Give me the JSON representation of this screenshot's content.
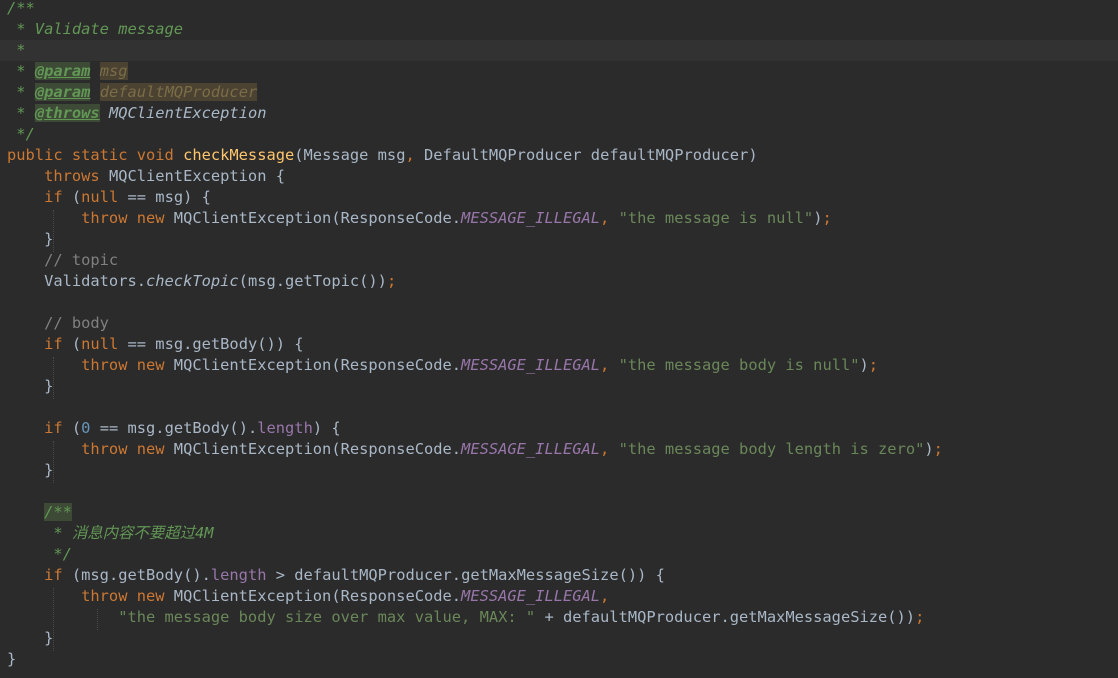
{
  "editor": {
    "theme": "darcula",
    "colors": {
      "background": "#2b2b2b",
      "current_line": "#323232",
      "default": "#a9b7c6",
      "keyword": "#cc7832",
      "string": "#6a8759",
      "doc_comment": "#629755",
      "line_comment": "#808080",
      "number": "#6897bb",
      "static_field": "#9876aa",
      "method_decl": "#ffc66d",
      "doc_tag": "#629755",
      "doc_tag_bg": "#3c4a36",
      "param_name_bg": "#4b4232"
    },
    "lines": [
      {
        "tokens": [
          {
            "t": "/**",
            "c": "doc_comment",
            "i": true
          }
        ]
      },
      {
        "tokens": [
          {
            "t": " * Validate message",
            "c": "doc_comment",
            "i": true
          }
        ]
      },
      {
        "current": true,
        "tokens": [
          {
            "t": " *",
            "c": "doc_comment",
            "i": true
          }
        ]
      },
      {
        "tokens": [
          {
            "t": " * ",
            "c": "doc_comment",
            "i": true
          },
          {
            "t": "@param",
            "c": "doc_tag",
            "i": true,
            "b": true,
            "u": true,
            "bg": "doc_tag_bg"
          },
          {
            "t": " ",
            "c": "doc_comment",
            "i": true
          },
          {
            "t": "msg",
            "c": "doc_comment",
            "i": true,
            "bg": "param_name_bg",
            "color": "#7a6d48"
          }
        ]
      },
      {
        "tokens": [
          {
            "t": " * ",
            "c": "doc_comment",
            "i": true
          },
          {
            "t": "@param",
            "c": "doc_tag",
            "i": true,
            "b": true,
            "u": true,
            "bg": "doc_tag_bg"
          },
          {
            "t": " ",
            "c": "doc_comment",
            "i": true
          },
          {
            "t": "defaultMQProducer",
            "c": "doc_comment",
            "i": true,
            "bg": "param_name_bg",
            "color": "#7a6d48"
          }
        ]
      },
      {
        "tokens": [
          {
            "t": " * ",
            "c": "doc_comment",
            "i": true
          },
          {
            "t": "@throws",
            "c": "doc_tag",
            "i": true,
            "b": true,
            "u": true,
            "bg": "doc_tag_bg"
          },
          {
            "t": " ",
            "c": "doc_comment",
            "i": true
          },
          {
            "t": "MQClientException",
            "c": "default",
            "i": true
          }
        ]
      },
      {
        "tokens": [
          {
            "t": " */",
            "c": "doc_comment",
            "i": true
          }
        ]
      },
      {
        "tokens": [
          {
            "t": "public static void ",
            "c": "keyword"
          },
          {
            "t": "checkMessage",
            "c": "method_decl"
          },
          {
            "t": "(Message msg",
            "c": "default"
          },
          {
            "t": ", ",
            "c": "keyword"
          },
          {
            "t": "DefaultMQProducer defaultMQProducer)",
            "c": "default"
          }
        ]
      },
      {
        "tokens": [
          {
            "t": "    throws ",
            "c": "keyword"
          },
          {
            "t": "MQClientException {",
            "c": "default"
          }
        ]
      },
      {
        "tokens": [
          {
            "t": "    if ",
            "c": "keyword"
          },
          {
            "t": "(",
            "c": "default"
          },
          {
            "t": "null ",
            "c": "keyword"
          },
          {
            "t": "== msg) {",
            "c": "default"
          }
        ]
      },
      {
        "tokens": [
          {
            "t": "        throw new ",
            "c": "keyword"
          },
          {
            "t": "MQClientException(ResponseCode.",
            "c": "default"
          },
          {
            "t": "MESSAGE_ILLEGAL",
            "c": "static_field",
            "i": true
          },
          {
            "t": ", ",
            "c": "keyword"
          },
          {
            "t": "\"the message is null\"",
            "c": "string"
          },
          {
            "t": ")",
            "c": "default"
          },
          {
            "t": ";",
            "c": "keyword"
          }
        ]
      },
      {
        "tokens": [
          {
            "t": "    }",
            "c": "default"
          }
        ]
      },
      {
        "tokens": [
          {
            "t": "    // topic",
            "c": "line_comment"
          }
        ]
      },
      {
        "tokens": [
          {
            "t": "    Validators.",
            "c": "default"
          },
          {
            "t": "checkTopic",
            "c": "default",
            "i": true
          },
          {
            "t": "(msg.getTopic())",
            "c": "default"
          },
          {
            "t": ";",
            "c": "keyword"
          }
        ]
      },
      {
        "tokens": []
      },
      {
        "tokens": [
          {
            "t": "    // body",
            "c": "line_comment"
          }
        ]
      },
      {
        "tokens": [
          {
            "t": "    if ",
            "c": "keyword"
          },
          {
            "t": "(",
            "c": "default"
          },
          {
            "t": "null ",
            "c": "keyword"
          },
          {
            "t": "== msg.getBody()) {",
            "c": "default"
          }
        ]
      },
      {
        "tokens": [
          {
            "t": "        throw new ",
            "c": "keyword"
          },
          {
            "t": "MQClientException(ResponseCode.",
            "c": "default"
          },
          {
            "t": "MESSAGE_ILLEGAL",
            "c": "static_field",
            "i": true
          },
          {
            "t": ", ",
            "c": "keyword"
          },
          {
            "t": "\"the message body is null\"",
            "c": "string"
          },
          {
            "t": ")",
            "c": "default"
          },
          {
            "t": ";",
            "c": "keyword"
          }
        ]
      },
      {
        "tokens": [
          {
            "t": "    }",
            "c": "default"
          }
        ]
      },
      {
        "tokens": []
      },
      {
        "tokens": [
          {
            "t": "    if ",
            "c": "keyword"
          },
          {
            "t": "(",
            "c": "default"
          },
          {
            "t": "0 ",
            "c": "number"
          },
          {
            "t": "== msg.getBody().",
            "c": "default"
          },
          {
            "t": "length",
            "c": "static_field"
          },
          {
            "t": ") {",
            "c": "default"
          }
        ]
      },
      {
        "tokens": [
          {
            "t": "        throw new ",
            "c": "keyword"
          },
          {
            "t": "MQClientException(ResponseCode.",
            "c": "default"
          },
          {
            "t": "MESSAGE_ILLEGAL",
            "c": "static_field",
            "i": true
          },
          {
            "t": ", ",
            "c": "keyword"
          },
          {
            "t": "\"the message body length is zero\"",
            "c": "string"
          },
          {
            "t": ")",
            "c": "default"
          },
          {
            "t": ";",
            "c": "keyword"
          }
        ]
      },
      {
        "tokens": [
          {
            "t": "    }",
            "c": "default"
          }
        ]
      },
      {
        "tokens": []
      },
      {
        "tokens": [
          {
            "t": "    ",
            "c": "default"
          },
          {
            "t": "/**",
            "c": "doc_comment",
            "i": true,
            "bg": "doc_tag_bg"
          }
        ]
      },
      {
        "tokens": [
          {
            "t": "     * 消息内容不要超过4M",
            "c": "doc_comment",
            "i": true
          }
        ]
      },
      {
        "tokens": [
          {
            "t": "     */",
            "c": "doc_comment",
            "i": true
          }
        ]
      },
      {
        "tokens": [
          {
            "t": "    if ",
            "c": "keyword"
          },
          {
            "t": "(msg.getBody().",
            "c": "default"
          },
          {
            "t": "length ",
            "c": "static_field"
          },
          {
            "t": "> defaultMQProducer.getMaxMessageSize()) {",
            "c": "default"
          }
        ]
      },
      {
        "tokens": [
          {
            "t": "        throw new ",
            "c": "keyword"
          },
          {
            "t": "MQClientException(ResponseCode.",
            "c": "default"
          },
          {
            "t": "MESSAGE_ILLEGAL",
            "c": "static_field",
            "i": true
          },
          {
            "t": ",",
            "c": "keyword"
          }
        ]
      },
      {
        "tokens": [
          {
            "t": "            ",
            "c": "default"
          },
          {
            "t": "\"the message body size over max value, MAX: \" ",
            "c": "string"
          },
          {
            "t": "+ defaultMQProducer.getMaxMessageSize())",
            "c": "default"
          },
          {
            "t": ";",
            "c": "keyword"
          }
        ]
      },
      {
        "tokens": [
          {
            "t": "    }",
            "c": "default"
          }
        ]
      },
      {
        "tokens": [
          {
            "t": "}",
            "c": "default"
          }
        ]
      }
    ]
  }
}
